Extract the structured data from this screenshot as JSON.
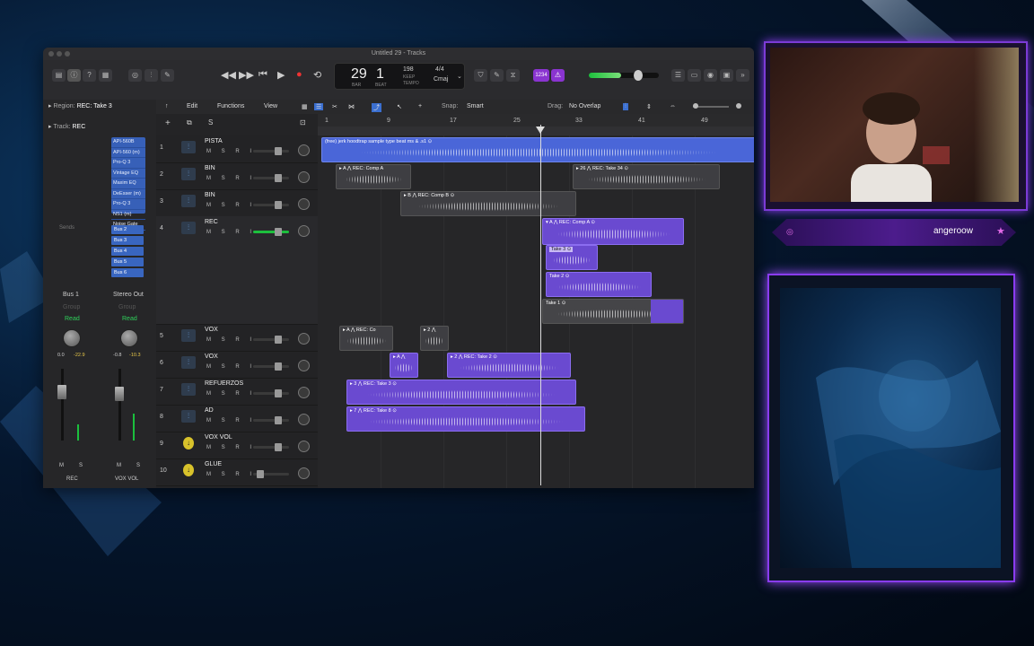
{
  "window": {
    "title": "Untitled 29 - Tracks"
  },
  "lcd": {
    "bar": "29",
    "beat": "1",
    "bar_label": "BAR",
    "beat_label": "BEAT",
    "tempo": "198",
    "tempo_label": "KEEP",
    "tempo_sub": "TEMPO",
    "signature": "4/4",
    "key": "Cmaj"
  },
  "toolbar": {
    "badge": "1234"
  },
  "inspector": {
    "region_label": "Region:",
    "region_value": "REC: Take 3",
    "track_label": "Track:",
    "track_value": "REC",
    "plugins": [
      "API-560B",
      "API-560 (m)",
      "Pro-Q 3",
      "Vintage EQ",
      "Maxim EQ",
      "DeEsser (m)",
      "Pro-Q 3",
      "NS1 (m)",
      "Noise Gate"
    ],
    "sends_label": "Sends",
    "buses": [
      "Bus 2",
      "Bus 3",
      "Bus 4",
      "Bus 5",
      "Bus 6"
    ],
    "ch1": {
      "output": "Bus 1",
      "group": "Group",
      "read": "Read",
      "vol": "0.0",
      "peak": "-22.9",
      "name": "REC"
    },
    "ch2": {
      "output": "Stereo Out",
      "group": "Group",
      "read": "Read",
      "vol": "-0.8",
      "peak": "-10.3",
      "name": "VOX VOL"
    },
    "m": "M",
    "s": "S"
  },
  "editbar": {
    "edit": "Edit",
    "functions": "Functions",
    "view": "View",
    "snap_label": "Snap:",
    "snap": "Smart",
    "drag_label": "Drag:",
    "drag": "No Overlap"
  },
  "ruler": [
    "1",
    "9",
    "17",
    "25",
    "33",
    "41",
    "49"
  ],
  "tracks": [
    {
      "num": "1",
      "name": "PISTA"
    },
    {
      "num": "2",
      "name": "BIN"
    },
    {
      "num": "3",
      "name": "BIN"
    },
    {
      "num": "4",
      "name": "REC"
    },
    {
      "num": "5",
      "name": "VOX"
    },
    {
      "num": "6",
      "name": "VOX"
    },
    {
      "num": "7",
      "name": "REFUERZOS"
    },
    {
      "num": "8",
      "name": "AD"
    },
    {
      "num": "9",
      "name": "VOX VOL"
    },
    {
      "num": "10",
      "name": "GLUE"
    }
  ],
  "track_buttons": "M S R I",
  "regions": {
    "pista": "(free) jerk hoodtrap  sample type beat ms & .s1 ⊙",
    "comp_a_bin": "▸ A ⋀ REC: Comp A",
    "take34": "▸ 26 ⋀ REC: Take 34 ⊙",
    "comp_b": "▸ B ⋀ REC: Comp B ⊙",
    "rec_comp_a": "▾ A ⋀ REC: Comp A ⊙",
    "take3": "Take 3 ⊙",
    "take2": "Take 2 ⊙",
    "take1": "Take 1 ⊙",
    "vox5a": "▸ A ⋀ REC: Co",
    "vox5b": "▸ 2 ⋀",
    "vox6a": "▸ A ⋀",
    "vox6b": "▸ 2 ⋀ REC: Take 2 ⊙",
    "ref": "▸ 3 ⋀ REC: Take 3 ⊙",
    "ad": "▸ 7 ⋀ REC: Take 8 ⊙"
  },
  "stream": {
    "username": "angeroow"
  },
  "colors": {
    "purple": "#6a4ad0",
    "blue": "#4a66d8",
    "accent": "#8a3cf0"
  }
}
